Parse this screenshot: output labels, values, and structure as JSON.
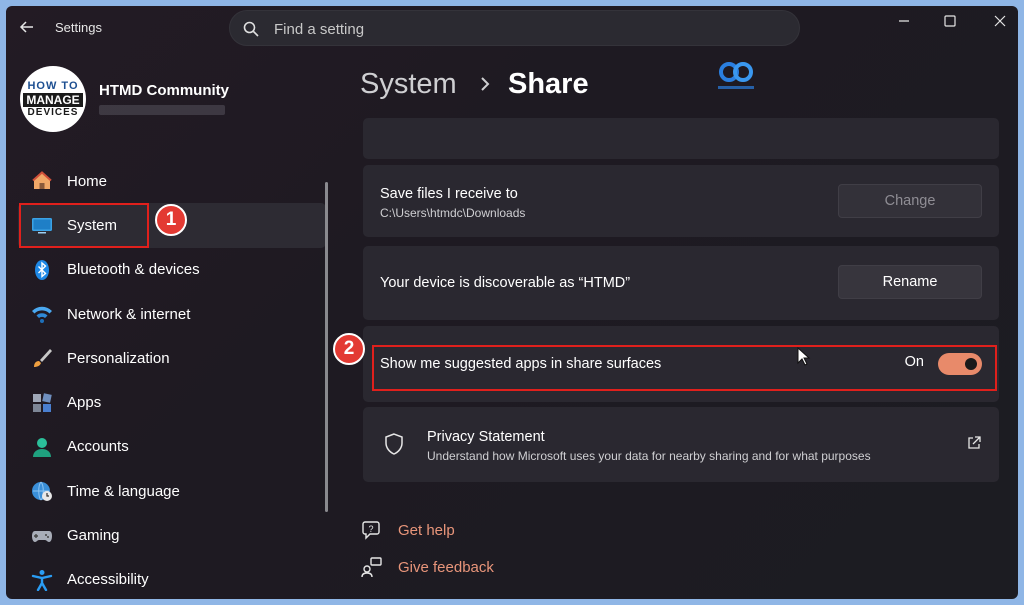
{
  "app": {
    "title": "Settings"
  },
  "search": {
    "placeholder": "Find a setting"
  },
  "profile": {
    "name": "HTMD Community",
    "avatar_text": [
      "HOW TO",
      "MANAGE",
      "DEVICES"
    ]
  },
  "sidebar": {
    "items": [
      {
        "label": "Home",
        "icon": "home-icon"
      },
      {
        "label": "System",
        "icon": "system-display-icon",
        "active": true
      },
      {
        "label": "Bluetooth & devices",
        "icon": "bluetooth-icon"
      },
      {
        "label": "Network & internet",
        "icon": "wifi-icon"
      },
      {
        "label": "Personalization",
        "icon": "brush-icon"
      },
      {
        "label": "Apps",
        "icon": "apps-icon"
      },
      {
        "label": "Accounts",
        "icon": "person-icon"
      },
      {
        "label": "Time & language",
        "icon": "globe-clock-icon"
      },
      {
        "label": "Gaming",
        "icon": "gamepad-icon"
      },
      {
        "label": "Accessibility",
        "icon": "accessibility-icon"
      }
    ]
  },
  "breadcrumb": {
    "parent": "System",
    "separator": "›",
    "current": "Share"
  },
  "cards": {
    "save_files": {
      "title": "Save files I receive to",
      "subtitle": "C:\\Users\\htmdc\\Downloads",
      "button": "Change"
    },
    "discoverable": {
      "title": "Your device is discoverable as “HTMD”",
      "button": "Rename"
    },
    "suggested_apps": {
      "title": "Show me suggested apps in share surfaces",
      "state_label": "On",
      "enabled": true
    },
    "privacy": {
      "title": "Privacy Statement",
      "subtitle": "Understand how Microsoft uses your data for nearby sharing and for what purposes"
    }
  },
  "links": {
    "help": "Get help",
    "feedback": "Give feedback"
  },
  "annotations": {
    "badge_1": "1",
    "badge_2": "2"
  },
  "colors": {
    "accent": "#e88a6a",
    "highlight": "#e0201c",
    "badge": "#e33a33",
    "link": "#e8957a"
  }
}
